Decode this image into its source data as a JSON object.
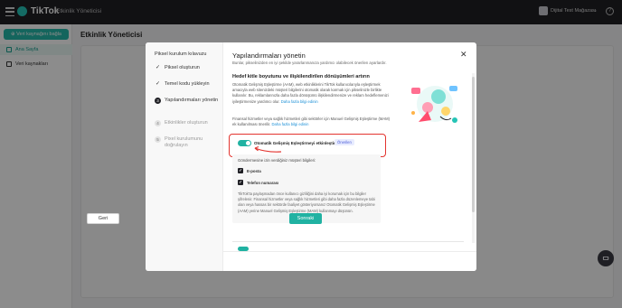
{
  "app": {
    "brand": "TikTok",
    "section": "Etkinlik Yöneticisi"
  },
  "account": {
    "name": "Dijital Test Mağazası"
  },
  "sidebar": {
    "connect_button": "Veri kaynağını bağla",
    "items": [
      {
        "label": "Ana Sayfa"
      },
      {
        "label": "Veri kaynakları"
      }
    ]
  },
  "page": {
    "title": "Etkinlik Yöneticisi"
  },
  "modal": {
    "steps_title": "Piksel kurulum kılavuzu",
    "steps": [
      {
        "label": "Piksel oluşturun"
      },
      {
        "label": "Temel kodu yükleyin"
      },
      {
        "num": "3",
        "label": "Yapılandırmaları yönetin"
      },
      {
        "num": "4",
        "label": "Etkinlikler oluşturun"
      },
      {
        "num": "5",
        "label": "Pixel kurulumunu doğrulayın"
      }
    ],
    "title": "Yapılandırmaları yönetin",
    "subtitle": "Bunlar, pikselinizden en iyi şekilde yararlanmanıza yardımcı olabilecek önerilen ayarlardır.",
    "section_title": "Hedef kitle boyutunu ve ilişkilendirilen dönüşümleri artırın",
    "section_desc": "Otomatik Gelişmiş Eşleştirme (AAM), web etkinliklerini TikTok kullanıcılarıyla eşleştirmek amacıyla web sitenizdeki müşteri bilgilerini otomatik olarak karmak için pikselinizle birlikte kullanılır. Bu, reklamlarınızla daha fazla dönüşümü ilişkilendirmenize ve reklam hedeflemenizi iyileştirmenize yardımcı olur.",
    "section_link": "Daha fazla bilgi edinin",
    "finance_note": "Finansal hizmetler veya sağlık hizmetleri gibi sektörler için Manuel Gelişmiş Eşleştirme (MAM) ek kullanılması önerilir.",
    "finance_link": "Daha fazla bilgi edinin",
    "auto_toggle_label": "Otomatik Gelişmiş Eşleştirmeyi etkinleştirin",
    "badge": "Önerilen",
    "detail_heading": "Göndermesine izin verdiğiniz müşteri bilgileri:",
    "checkboxes": [
      {
        "label": "E-posta"
      },
      {
        "label": "Telefon numarası"
      }
    ],
    "detail_note": "TikTok'ta paylaşmadan önce kullanıcı gizliliğini daha iyi korumak için bu bilgiler şifrelenir. Finansal hizmetler veya sağlık hizmetleri gibi daha fazla düzenlemeye tabi olan veya hassas bir sektörde faaliyet gösteriyorsanız Otomatik Gelişmiş Eşleştirme (AAM) yerine Manuel Gelişmiş Eşleştirme (MAM) kullanmayı düşünün.",
    "back_button": "Geri",
    "next_button": "Sonraki"
  },
  "colors": {
    "accent": "#20b2a2",
    "highlight": "#e3342f",
    "topbar": "#1f1f24"
  }
}
